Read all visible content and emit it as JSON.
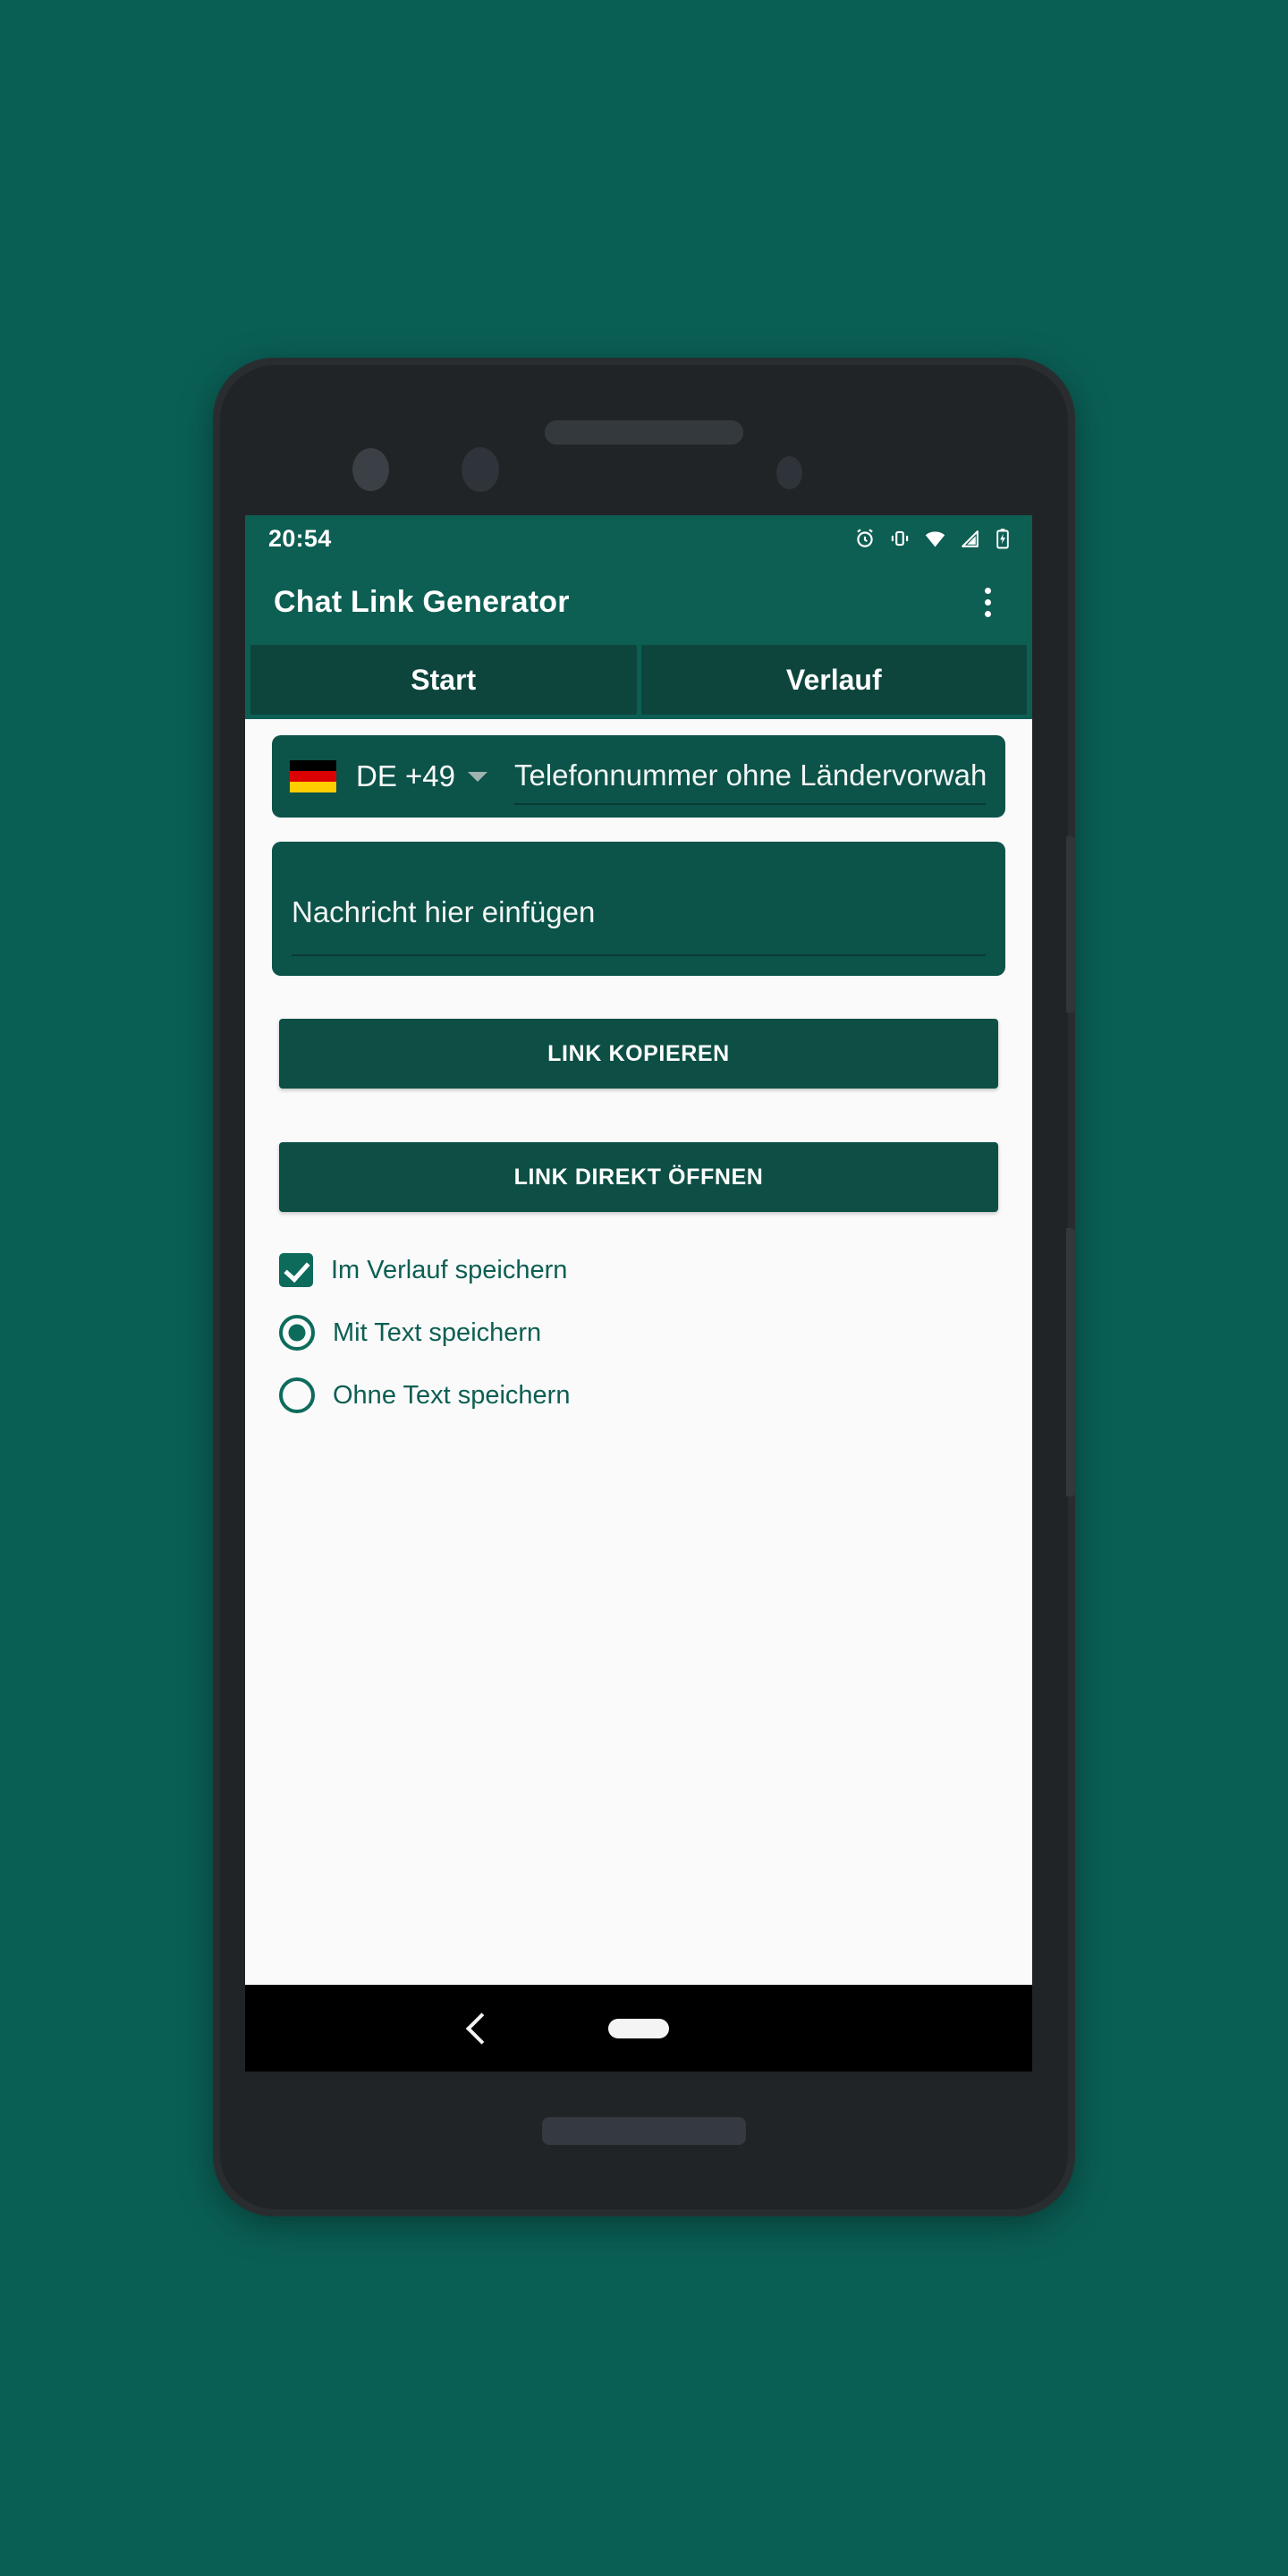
{
  "colors": {
    "page_background": "#0a5f55",
    "app_bar": "#0d5e53",
    "tab_inactive": "#0d453d",
    "field_fill": "#0c5349",
    "button_fill": "#0d4f45",
    "accent": "#0d6b5c",
    "screen_background": "#fafafa",
    "nav_bar": "#000000"
  },
  "device": {
    "name": "android-phone-mockup",
    "hardware": {
      "earpiece": "speaker-grille",
      "lenses": [
        "sensor-dot",
        "front-camera-dot",
        "led-dot"
      ],
      "side_buttons": [
        "volume-rocker",
        "power-button"
      ],
      "bottom_speaker": "speaker-grille"
    }
  },
  "status_bar": {
    "clock": "20:54",
    "icons": [
      "alarm-icon",
      "vibrate-icon",
      "wifi-icon",
      "cellular-signal-icon",
      "battery-charging-icon"
    ]
  },
  "app_bar": {
    "title": "Chat Link Generator",
    "overflow_icon": "more-vert-icon"
  },
  "tabs": [
    {
      "label": "Start",
      "selected": true
    },
    {
      "label": "Verlauf",
      "selected": false
    }
  ],
  "form": {
    "country": {
      "flag": "flag-de-icon",
      "code_label": "DE  +49",
      "caret_icon": "chevron-down-icon"
    },
    "phone": {
      "value": "",
      "placeholder": "Telefonnummer ohne Ländervorwahl"
    },
    "message": {
      "value": "",
      "placeholder": "Nachricht hier einfügen"
    }
  },
  "actions": {
    "copy_link": "LINK KOPIEREN",
    "open_link": "LINK DIREKT ÖFFNEN"
  },
  "options": {
    "save_to_history": {
      "label": "Im Verlauf speichern",
      "checked": true
    },
    "save_mode": [
      {
        "label": "Mit Text speichern",
        "selected": true
      },
      {
        "label": "Ohne Text speichern",
        "selected": false
      }
    ]
  },
  "nav_bar": {
    "back_icon": "back-chevron-icon",
    "home_icon": "home-pill-icon"
  }
}
